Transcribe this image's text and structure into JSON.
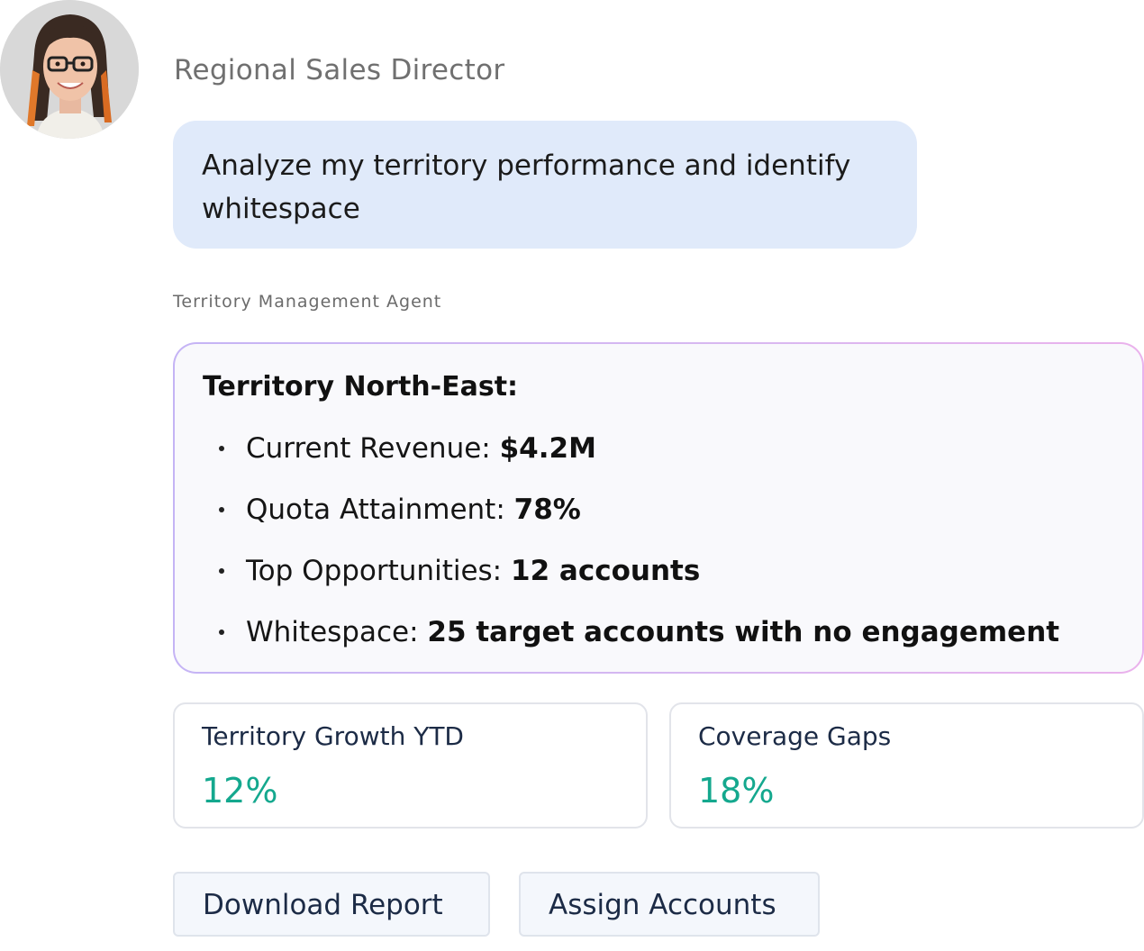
{
  "user": {
    "role": "Regional Sales Director",
    "message": "Analyze my territory performance and identify whitespace"
  },
  "agent": {
    "name": "Territory Management Agent",
    "heading": "Territory North-East:",
    "items": [
      {
        "label": "Current Revenue: ",
        "value": "$4.2M"
      },
      {
        "label": "Quota Attainment: ",
        "value": "78%"
      },
      {
        "label": "Top Opportunities: ",
        "value": "12 accounts"
      },
      {
        "label": "Whitespace: ",
        "value": "25 target accounts with no engagement"
      }
    ]
  },
  "stats": [
    {
      "label": "Territory Growth YTD",
      "value": "12%"
    },
    {
      "label": "Coverage Gaps",
      "value": "18%"
    }
  ],
  "actions": {
    "download_label": "Download Report",
    "assign_label": "Assign Accounts"
  },
  "colors": {
    "user_bubble": "#e0eafa",
    "stat_value": "#14a88e",
    "card_border_start": "#c5b4f5",
    "card_border_end": "#eab2ec"
  }
}
